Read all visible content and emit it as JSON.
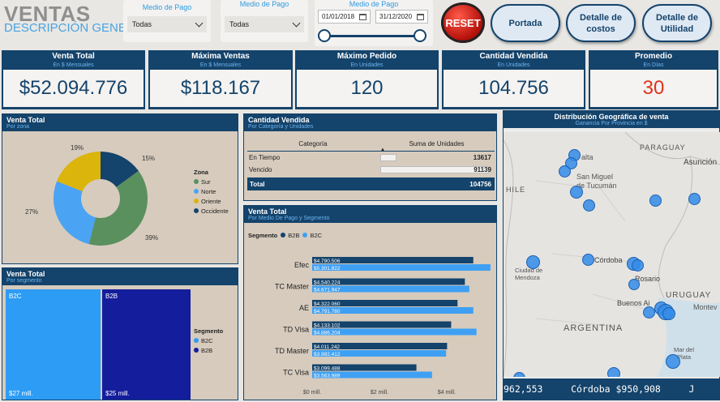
{
  "header": {
    "title": "VENTAS",
    "subtitle": "DESCRIPCIÓN GENERAL"
  },
  "filters": {
    "medio_pago_1": {
      "label": "Medio de Pago",
      "value": "Todas"
    },
    "medio_pago_2": {
      "label": "Medio de Pago",
      "value": "Todas"
    },
    "date_range": {
      "label": "Medio de Pago",
      "start": "01/01/2018",
      "end": "31/12/2020"
    }
  },
  "reset_label": "RESET",
  "nav": {
    "portada": "Portada",
    "detalle_costos_1": "Detalle de",
    "detalle_costos_2": "costos",
    "detalle_utilidad_1": "Detalle de",
    "detalle_utilidad_2": "Utilidad"
  },
  "kpis": [
    {
      "title": "Venta Total",
      "subtitle": "En $ Mensuales",
      "value": "$52.094.776"
    },
    {
      "title": "Máxima Ventas",
      "subtitle": "En $ Mensuales",
      "value": "$118.167"
    },
    {
      "title": "Máximo Pedido",
      "subtitle": "En Unidades",
      "value": "120"
    },
    {
      "title": "Cantidad Vendida",
      "subtitle": "En Unidades",
      "value": "104.756"
    },
    {
      "title": "Promedio",
      "subtitle": "En Días",
      "value": "30",
      "value_color": "#e0321c"
    }
  ],
  "venta_zona": {
    "title": "Venta Total",
    "subtitle": "Por zona",
    "legend_title": "Zona",
    "chart_data": {
      "type": "pie",
      "categories": [
        "Sur",
        "Norte",
        "Oriente",
        "Occidente"
      ],
      "values": [
        39,
        27,
        19,
        15
      ],
      "labels": [
        "39%",
        "27%",
        "19%",
        "15%"
      ],
      "colors": [
        "#5a8f5e",
        "#4aa3f3",
        "#dbb40c",
        "#14436b"
      ]
    }
  },
  "venta_segmento": {
    "title": "Venta Total",
    "subtitle": "Por segmento",
    "legend_title": "Segmento",
    "chart_data": {
      "type": "treemap",
      "categories": [
        "B2C",
        "B2B"
      ],
      "values": [
        27,
        25
      ],
      "labels": [
        "$27 mill.",
        "$25 mill."
      ],
      "colors": [
        "#2d9cf5",
        "#141d9c"
      ]
    }
  },
  "cantidad_vendida": {
    "title": "Cantidad Vendida",
    "subtitle": "Por Categoría y Unidades",
    "columns": [
      "Categoría",
      "Suma de Unidades"
    ],
    "rows": [
      {
        "label": "En Tiempo",
        "value": "13617",
        "num": 13617
      },
      {
        "label": "Vencido",
        "value": "91139",
        "num": 91139
      }
    ],
    "total": {
      "label": "Total",
      "value": "104756"
    }
  },
  "venta_medio": {
    "title": "Venta Total",
    "subtitle": "Por Medio De Pago y Segmento",
    "legend_title": "Segmento",
    "chart_data": {
      "type": "bar",
      "categories": [
        "Efec",
        "TC Master",
        "AE",
        "TD Visa",
        "TD Master",
        "TC Visa"
      ],
      "series": [
        {
          "name": "B2B",
          "color": "#14436b",
          "values": [
            4790506,
            4540224,
            4322060,
            4133102,
            4011242,
            3099488
          ],
          "labels": [
            "$4.790.506",
            "$4.540.224",
            "$4.322.060",
            "$4.133.102",
            "$4.011.242",
            "$3.099.488"
          ]
        },
        {
          "name": "B2C",
          "color": "#3fa0f3",
          "values": [
            5301822,
            4671947,
            4791780,
            4886204,
            3982412,
            3563989
          ],
          "labels": [
            "$5.301.822",
            "$4.671.947",
            "$4.791.780",
            "$4.886.204",
            "$3.982.412",
            "$3.563.989"
          ]
        }
      ],
      "x_ticks": [
        "$0 mill.",
        "$2 mill.",
        "$4 mill."
      ],
      "xlim": [
        0,
        5400000
      ]
    }
  },
  "mapa": {
    "title": "Distribución Geográfica de venta",
    "subtitle": "Ganancia Por Provincia en $",
    "labels": {
      "paraguay": "PARAGUAY",
      "asuncion": "Asunción",
      "salta": "alta",
      "tucuman1": "San Miguel",
      "tucuman2": "de Tucumán",
      "chile": "HILE",
      "cordoba": "Córdoba",
      "mendoza1": "Ciudad de",
      "mendoza2": "Mendoza",
      "rosario": "Rosario",
      "buenos": "Buenos Ai",
      "uruguay": "URUGUAY",
      "montev": "Montev",
      "argentina": "ARGENTINA",
      "mardel1": "Mar del",
      "mardel2": "Plata"
    },
    "ticker": "962,553     Córdoba $950,908     J"
  }
}
